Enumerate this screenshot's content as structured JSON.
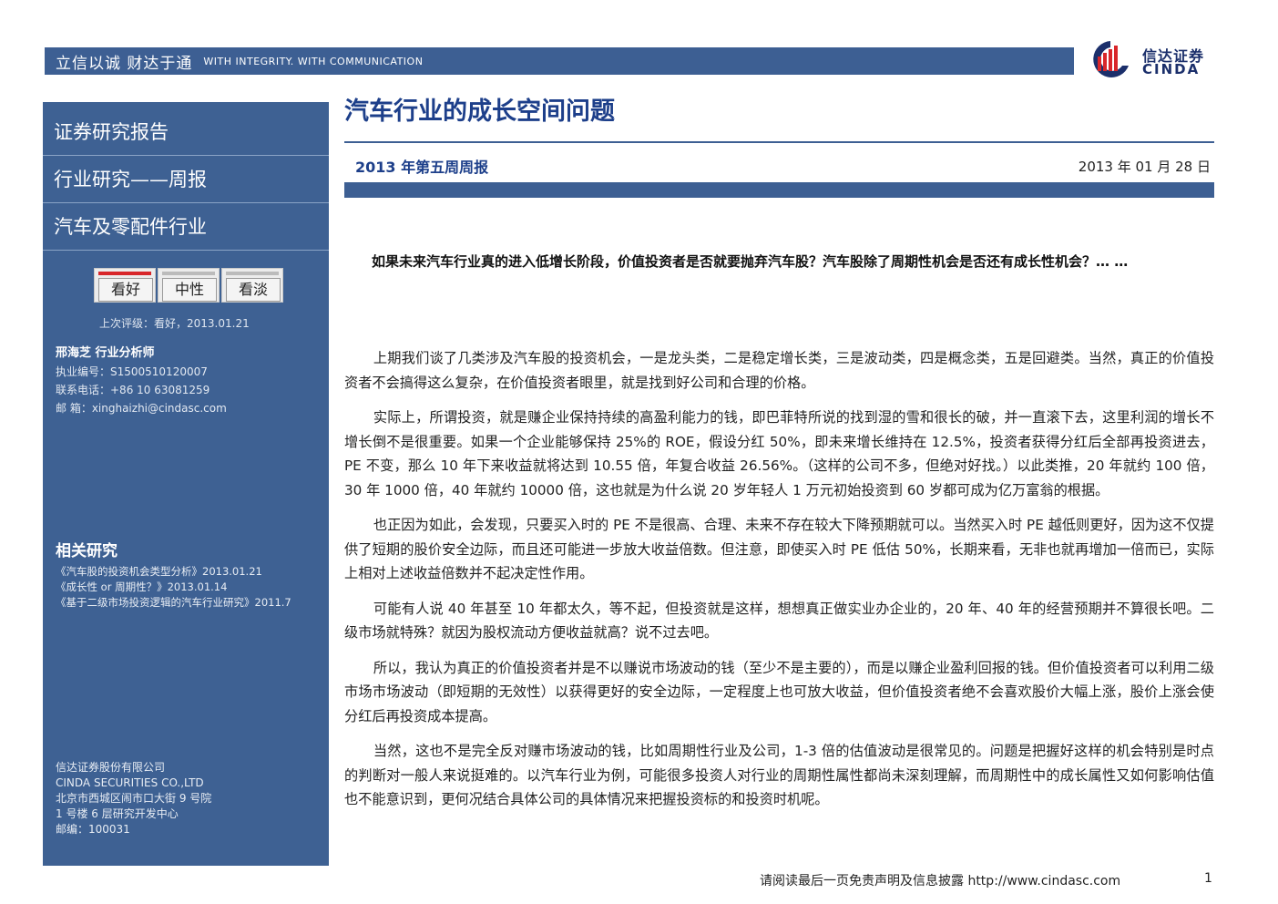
{
  "header": {
    "slogan_cn": "立信以诚  财达于通",
    "slogan_en": "WITH INTEGRITY. WITH COMMUNICATION",
    "logo_cn": "信达证券",
    "logo_en": "CINDA"
  },
  "sidebar": {
    "report_type": "证券研究报告",
    "category": "行业研究——周报",
    "industry": "汽车及零配件行业",
    "ratings": [
      {
        "label": "看好",
        "active": true
      },
      {
        "label": "中性",
        "active": false
      },
      {
        "label": "看淡",
        "active": false
      }
    ],
    "last_rating": "上次评级：看好，2013.01.21",
    "analyst": {
      "name": "邢海芝  行业分析师",
      "license": "执业编号：S1500510120007",
      "phone": "联系电话：+86 10 63081259",
      "email": "邮    箱：xinghaizhi@cindasc.com"
    },
    "related": {
      "title": "相关研究",
      "items": [
        "《汽车股的投资机会类型分析》2013.01.21",
        "《成长性 or 周期性？》2013.01.14",
        "《基于二级市场投资逻辑的汽车行业研究》2011.7"
      ]
    },
    "company": {
      "name_cn": "信达证券股份有限公司",
      "name_en": "CINDA SECURITIES CO.,LTD",
      "address1": "北京市西城区闹市口大街 9 号院",
      "address2": "1 号楼 6 层研究开发中心",
      "postcode": "邮编：100031"
    }
  },
  "report": {
    "title": "汽车行业的成长空间问题",
    "subtitle": "2013 年第五周周报",
    "date": "2013 年 01 月 28 日",
    "summary": "如果未来汽车行业真的进入低增长阶段，价值投资者是否就要抛弃汽车股？汽车股除了周期性机会是否还有成长性机会？… …",
    "paragraphs": [
      "上期我们谈了几类涉及汽车股的投资机会，一是龙头类，二是稳定增长类，三是波动类，四是概念类，五是回避类。当然，真正的价值投资者不会搞得这么复杂，在价值投资者眼里，就是找到好公司和合理的价格。",
      "实际上，所谓投资，就是赚企业保持持续的高盈利能力的钱，即巴菲特所说的找到湿的雪和很长的破，并一直滚下去，这里利润的增长不增长倒不是很重要。如果一个企业能够保持 25%的 ROE，假设分红 50%，即未来增长维持在 12.5%，投资者获得分红后全部再投资进去，PE 不变，那么 10 年下来收益就将达到 10.55 倍，年复合收益 26.56%。（这样的公司不多，但绝对好找。）以此类推，20 年就约 100 倍，30 年 1000 倍，40 年就约 10000 倍，这也就是为什么说 20 岁年轻人 1 万元初始投资到 60 岁都可成为亿万富翁的根据。",
      "也正因为如此，会发现，只要买入时的 PE 不是很高、合理、未来不存在较大下降预期就可以。当然买入时 PE 越低则更好，因为这不仅提供了短期的股价安全边际，而且还可能进一步放大收益倍数。但注意，即使买入时 PE 低估 50%，长期来看，无非也就再增加一倍而已，实际上相对上述收益倍数并不起决定性作用。",
      "可能有人说 40 年甚至 10 年都太久，等不起，但投资就是这样，想想真正做实业办企业的，20 年、40 年的经营预期并不算很长吧。二级市场就特殊？就因为股权流动方便收益就高？说不过去吧。",
      "所以，我认为真正的价值投资者并是不以赚说市场波动的钱（至少不是主要的），而是以赚企业盈利回报的钱。但价值投资者可以利用二级市场市场波动（即短期的无效性）以获得更好的安全边际，一定程度上也可放大收益，但价值投资者绝不会喜欢股价大幅上涨，股价上涨会使分红后再投资成本提高。",
      "当然，这也不是完全反对赚市场波动的钱，比如周期性行业及公司，1-3 倍的估值波动是很常见的。问题是把握好这样的机会特别是时点的判断对一般人来说挺难的。以汽车行业为例，可能很多投资人对行业的周期性属性都尚未深刻理解，而周期性中的成长属性又如何影响估值也不能意识到，更何况结合具体公司的具体情况来把握投资标的和投资时机呢。"
    ]
  },
  "footer": {
    "notice": "请阅读最后一页免责声明及信息披露  http://www.cindasc.com",
    "page": "1"
  },
  "colors": {
    "brand_blue": "#3d5f93",
    "title_blue": "#1d3f8a",
    "rating_active": "#d8262a"
  }
}
